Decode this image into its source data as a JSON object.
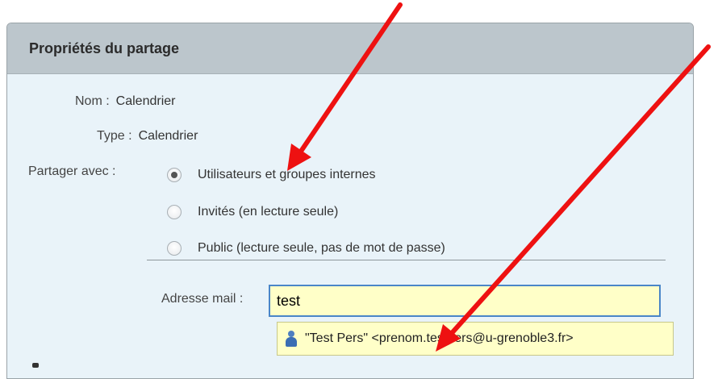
{
  "dialog": {
    "title": "Propriétés du partage",
    "name_label": "Nom :",
    "name_value": "Calendrier",
    "type_label": "Type :",
    "type_value": "Calendrier",
    "share_label": "Partager avec :",
    "share_options": [
      {
        "label": "Utilisateurs et groupes internes",
        "selected": true
      },
      {
        "label": "Invités (en lecture seule)",
        "selected": false
      },
      {
        "label": "Public (lecture seule, pas de mot de passe)",
        "selected": false
      }
    ],
    "email_label": "Adresse mail :",
    "email_value": "test",
    "suggestion": "\"Test Pers\" <prenom.testpers@u-grenoble3.fr>"
  },
  "colors": {
    "titlebar": "#bcc6cc",
    "panel": "#e9f3f9",
    "input_bg": "#ffffc8",
    "input_border": "#4a86c8",
    "annotation_arrow": "#ee1111"
  }
}
